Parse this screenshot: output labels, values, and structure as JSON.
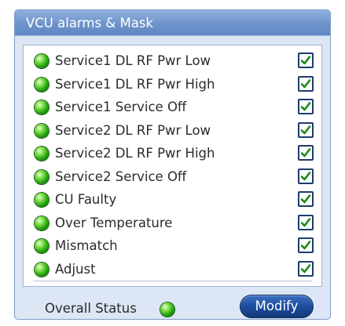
{
  "panel": {
    "title": "VCU alarms & Mask",
    "alarms": [
      {
        "label": "Service1 DL RF Pwr Low",
        "status": "ok",
        "masked": true
      },
      {
        "label": "Service1 DL RF Pwr High",
        "status": "ok",
        "masked": true
      },
      {
        "label": "Service1 Service Off",
        "status": "ok",
        "masked": true
      },
      {
        "label": "Service2 DL RF Pwr Low",
        "status": "ok",
        "masked": true
      },
      {
        "label": "Service2 DL RF Pwr High",
        "status": "ok",
        "masked": true
      },
      {
        "label": "Service2 Service Off",
        "status": "ok",
        "masked": true
      },
      {
        "label": "CU Faulty",
        "status": "ok",
        "masked": true
      },
      {
        "label": "Over Temperature",
        "status": "ok",
        "masked": true
      },
      {
        "label": "Mismatch",
        "status": "ok",
        "masked": true
      },
      {
        "label": "Adjust",
        "status": "ok",
        "masked": true
      }
    ],
    "overall_status_label": "Overall Status",
    "overall_status": "ok",
    "modify_label": "Modify"
  },
  "icons": {
    "status_led": "green-led-icon",
    "mask_checkbox": "checked-checkbox-icon"
  },
  "colors": {
    "led_ok": "#1fa00c",
    "title_bar": "#6f94cb",
    "panel_bg": "#dce6f4",
    "button": "#1e4f9e"
  }
}
